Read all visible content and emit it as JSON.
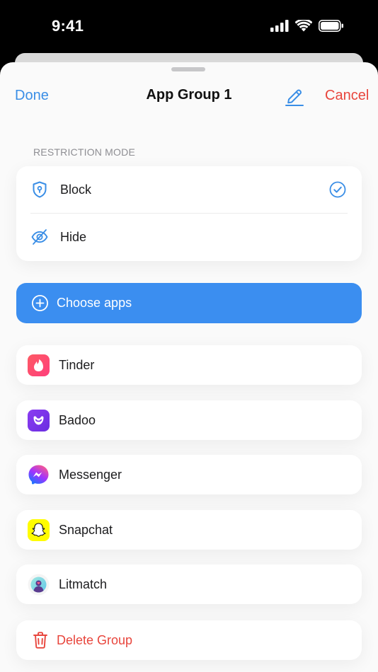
{
  "status_bar": {
    "time": "9:41"
  },
  "nav": {
    "done_label": "Done",
    "title": "App Group 1",
    "edit_icon": "pencil-icon",
    "cancel_label": "Cancel"
  },
  "restriction": {
    "section_label": "RESTRICTION MODE",
    "modes": [
      {
        "label": "Block",
        "icon": "shield-lock-icon",
        "selected": true
      },
      {
        "label": "Hide",
        "icon": "eye-slash-icon",
        "selected": false
      }
    ]
  },
  "choose_apps": {
    "label": "Choose apps",
    "icon": "plus-circle-icon"
  },
  "apps": [
    {
      "label": "Tinder",
      "icon": "tinder-icon"
    },
    {
      "label": "Badoo",
      "icon": "badoo-icon"
    },
    {
      "label": "Messenger",
      "icon": "messenger-icon"
    },
    {
      "label": "Snapchat",
      "icon": "snapchat-icon"
    },
    {
      "label": "Litmatch",
      "icon": "litmatch-icon"
    }
  ],
  "delete_group": {
    "label": "Delete Group",
    "icon": "trash-icon"
  },
  "colors": {
    "accent": "#3a8ee6",
    "primary_button": "#3b8ef0",
    "destructive": "#e8453c"
  }
}
